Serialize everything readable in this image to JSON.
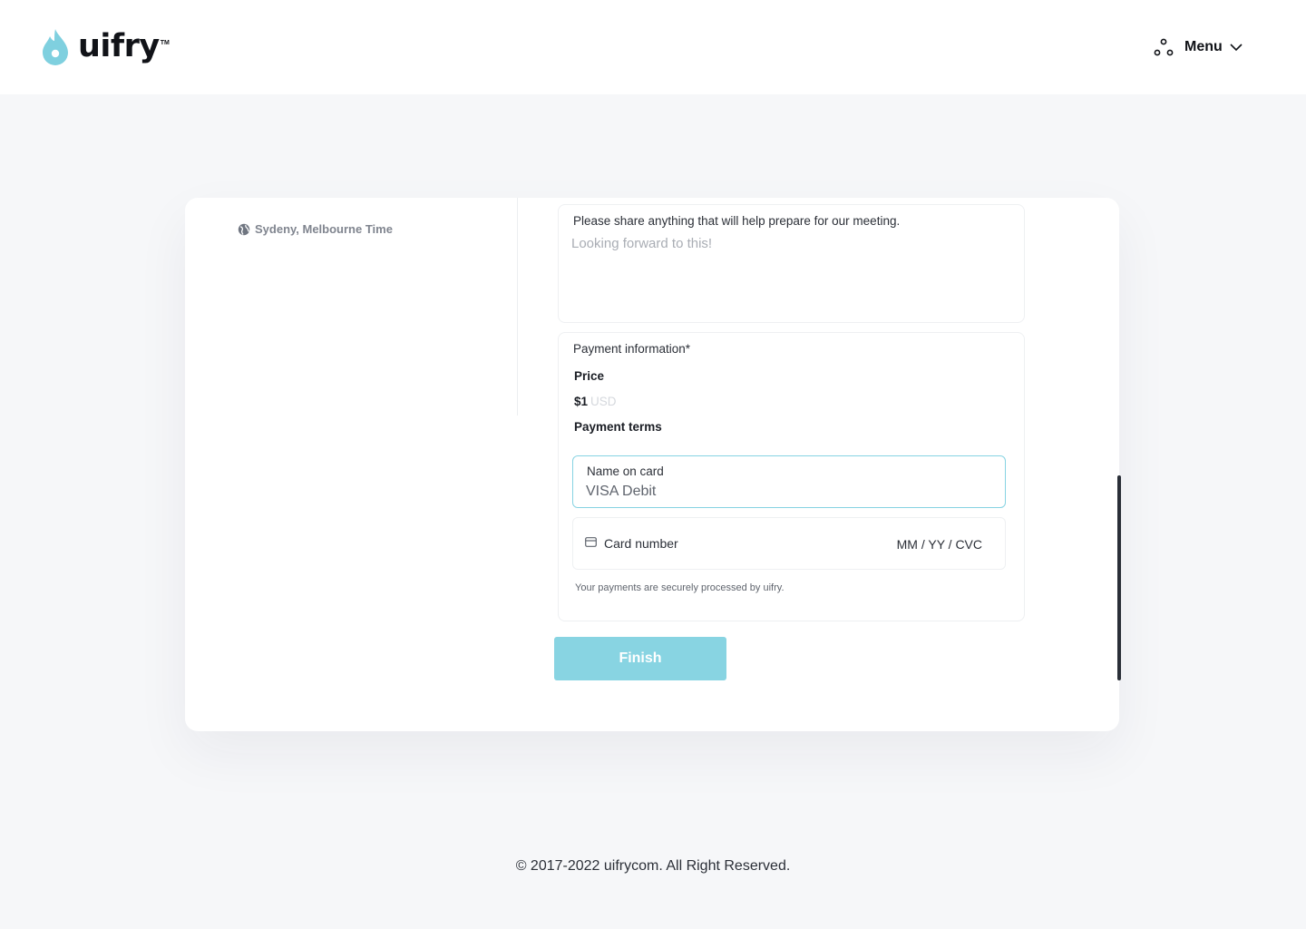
{
  "brand": {
    "name": "uifry",
    "trademark": "TM",
    "icon": "flame-drop-icon",
    "accent_color": "#7fd0df"
  },
  "header": {
    "menu_label": "Menu",
    "menu_icon": "dots-triangle-icon",
    "chevron_icon": "chevron-down-icon"
  },
  "sidebar": {
    "timezone_label": "Sydeny, Melbourne Time",
    "timezone_icon": "globe-icon"
  },
  "notes": {
    "label": "Please share anything that will help prepare for our meeting.",
    "placeholder": "Looking forward to this!"
  },
  "payment": {
    "section_label": "Payment information*",
    "price_label": "Price",
    "price_amount": "$1",
    "price_currency": "USD",
    "terms_label": "Payment terms",
    "name_field": {
      "label": "Name on card",
      "value": "VISA Debit"
    },
    "card_field": {
      "label": "Card number",
      "expiry_cvc": "MM / YY / CVC",
      "icon": "credit-card-icon"
    },
    "secure_note": "Your payments are securely processed by uifry."
  },
  "actions": {
    "finish_label": "Finish",
    "finish_color": "#88d4e2"
  },
  "footer": {
    "copyright": "© 2017-2022  uifrycom. All Right Reserved."
  }
}
